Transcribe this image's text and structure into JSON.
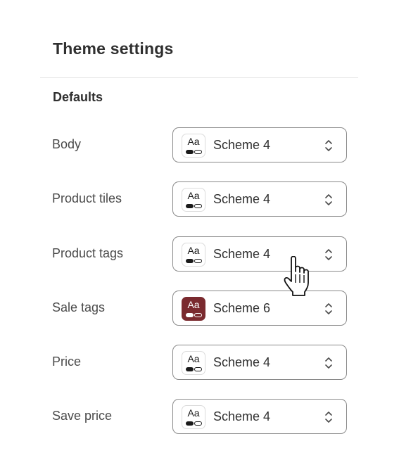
{
  "page": {
    "title": "Theme settings"
  },
  "defaults": {
    "section_title": "Defaults",
    "rows": [
      {
        "label": "Body",
        "value": "Scheme 4",
        "swatch_text": "Aa",
        "swatch_color": "#ffffff"
      },
      {
        "label": "Product tiles",
        "value": "Scheme 4",
        "swatch_text": "Aa",
        "swatch_color": "#ffffff"
      },
      {
        "label": "Product tags",
        "value": "Scheme 4",
        "swatch_text": "Aa",
        "swatch_color": "#ffffff"
      },
      {
        "label": "Sale tags",
        "value": "Scheme 6",
        "swatch_text": "Aa",
        "swatch_color": "#7a2a2f"
      },
      {
        "label": "Price",
        "value": "Scheme 4",
        "swatch_text": "Aa",
        "swatch_color": "#ffffff"
      },
      {
        "label": "Save price",
        "value": "Scheme 4",
        "swatch_text": "Aa",
        "swatch_color": "#ffffff"
      }
    ]
  },
  "icons": {
    "select_arrow": "chevron-up-down-icon",
    "swatch": "color-scheme-swatch-icon",
    "cursor": "hand-pointer-cursor"
  }
}
